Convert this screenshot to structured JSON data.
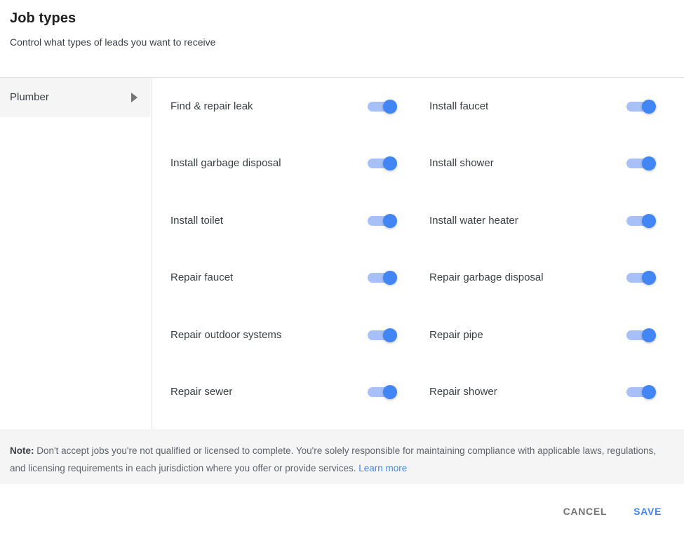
{
  "header": {
    "title": "Job types",
    "subtitle": "Control what types of leads you want to receive"
  },
  "sidebar": {
    "items": [
      {
        "label": "Plumber",
        "icon": "arrow-right-icon",
        "selected": true
      }
    ]
  },
  "job_types": {
    "left_column": [
      {
        "label": "Find & repair leak",
        "enabled": true
      },
      {
        "label": "Install garbage disposal",
        "enabled": true
      },
      {
        "label": "Install toilet",
        "enabled": true
      },
      {
        "label": "Repair faucet",
        "enabled": true
      },
      {
        "label": "Repair outdoor systems",
        "enabled": true
      },
      {
        "label": "Repair sewer",
        "enabled": true
      }
    ],
    "right_column": [
      {
        "label": "Install faucet",
        "enabled": true
      },
      {
        "label": "Install shower",
        "enabled": true
      },
      {
        "label": "Install water heater",
        "enabled": true
      },
      {
        "label": "Repair garbage disposal",
        "enabled": true
      },
      {
        "label": "Repair pipe",
        "enabled": true
      },
      {
        "label": "Repair shower",
        "enabled": true
      }
    ]
  },
  "note": {
    "prefix": "Note:",
    "text": " Don't accept jobs you're not qualified or licensed to complete. You're solely responsible for maintaining compliance with applicable laws, regulations, and licensing requirements in each jurisdiction where you offer or provide services. ",
    "link_label": "Learn more"
  },
  "footer": {
    "cancel_label": "CANCEL",
    "save_label": "SAVE"
  },
  "colors": {
    "accent": "#4285f4",
    "toggle_track_on": "#a7c0f8",
    "sidebar_selected_bg": "#f5f5f5",
    "note_bg": "#f5f5f5",
    "divider": "#e0e0e0",
    "text_primary": "#3c4043",
    "text_secondary": "#5f6368"
  }
}
